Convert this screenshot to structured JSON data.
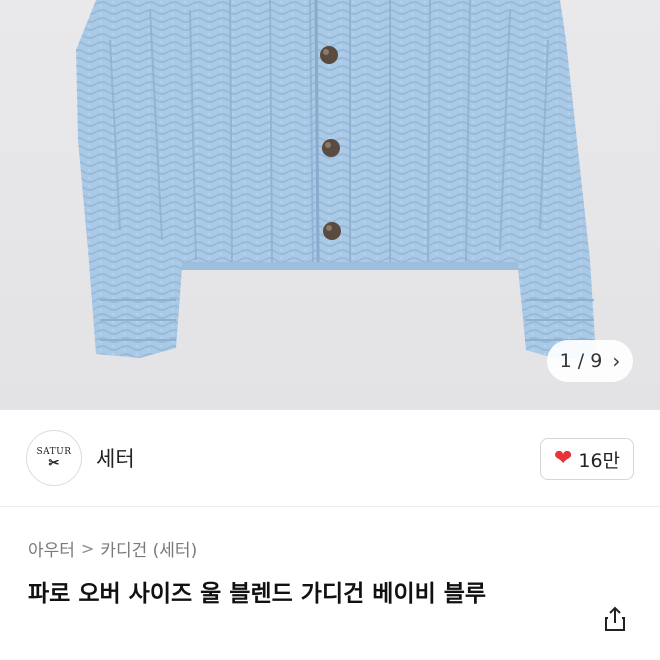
{
  "gallery": {
    "image_alt": "baby blue wool blend cardigan",
    "counter_current": "1",
    "counter_sep": "/",
    "counter_total": "9",
    "next_icon": "chevron-right-icon"
  },
  "brand": {
    "logo_text_top": "SATUR",
    "logo_text_mark": "✂",
    "name": "세터"
  },
  "like": {
    "icon": "heart-icon",
    "count": "16만"
  },
  "breadcrumb": {
    "level1": "아우터",
    "separator": ">",
    "level2": "카디건 (세터)"
  },
  "product": {
    "title": "파로 오버 사이즈 울 블렌드 가디건 베이비 블루"
  },
  "colors": {
    "heart": "#e8323c",
    "cardigan": "#a9c9e6"
  }
}
